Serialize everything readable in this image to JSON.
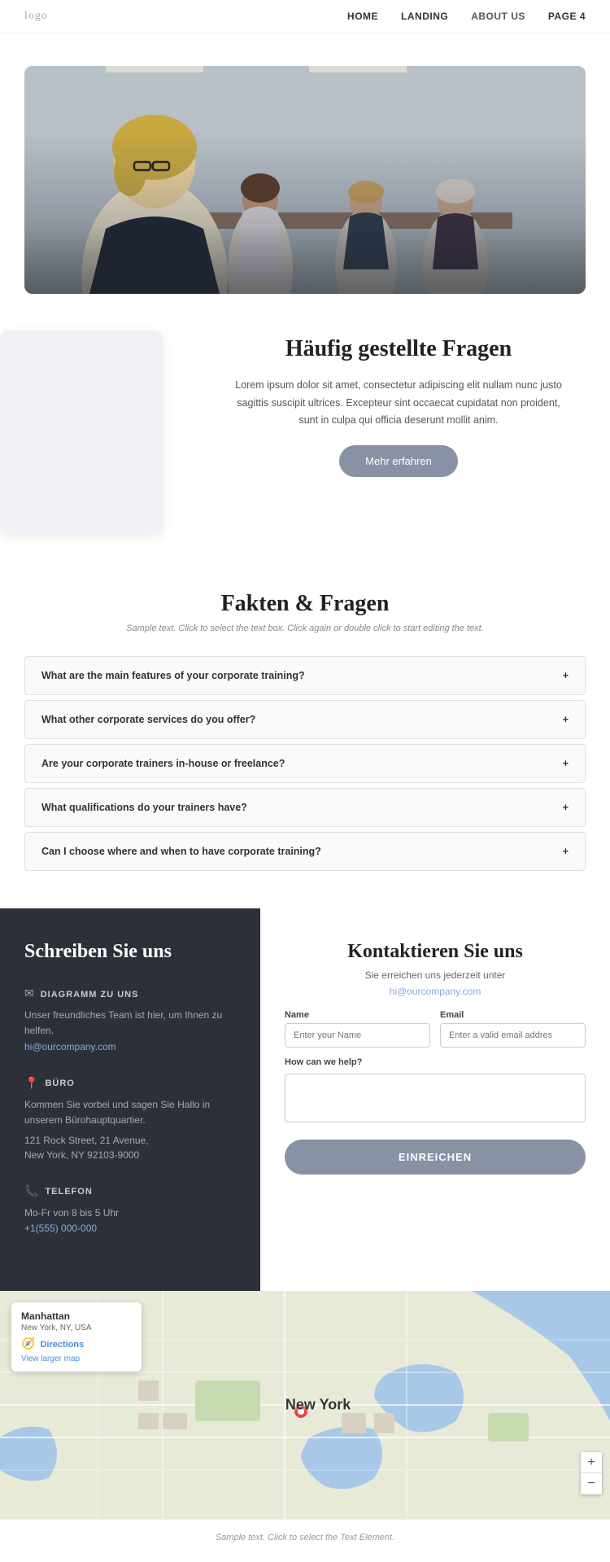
{
  "nav": {
    "logo": "logo",
    "links": [
      {
        "label": "HOME",
        "active": false
      },
      {
        "label": "LANDING",
        "active": false
      },
      {
        "label": "ABOUT US",
        "active": true
      },
      {
        "label": "PAGE 4",
        "active": false
      }
    ]
  },
  "hero": {
    "title": "Häufig gestellte Fragen",
    "body": "Lorem ipsum dolor sit amet, consectetur adipiscing elit nullam nunc justo sagittis suscipit ultrices. Excepteur sint occaecat cupidatat non proident, sunt in culpa qui officia deserunt mollit anim.",
    "button": "Mehr erfahren"
  },
  "faq_section": {
    "title": "Fakten & Fragen",
    "subtitle": "Sample text. Click to select the text box. Click again or double click to start editing the text.",
    "items": [
      "What are the main features of your corporate training?",
      "What other corporate services do you offer?",
      "Are your corporate trainers in-house or freelance?",
      "What qualifications do your trainers have?",
      "Can I choose where and when to have corporate training?"
    ]
  },
  "contact_left": {
    "title": "Schreiben Sie uns",
    "blocks": [
      {
        "icon": "✉",
        "heading": "DIAGRAMM ZU UNS",
        "text": "Unser freundliches Team ist hier, um Ihnen zu helfen.",
        "link": "hi@ourcompany.com"
      },
      {
        "icon": "📍",
        "heading": "BÜRO",
        "text": "Kommen Sie vorbei und sagen Sie Hallo in unserem Bürohauptquartier.",
        "address": "121 Rock Street, 21 Avenue,\nNew York, NY 92103-9000"
      },
      {
        "icon": "📞",
        "heading": "TELEFON",
        "text": "Mo-Fr von 8 bis 5 Uhr",
        "link": "+1(555) 000-000"
      }
    ]
  },
  "contact_right": {
    "title": "Kontaktieren Sie uns",
    "subtitle": "Sie erreichen uns jederzeit unter",
    "email_hint": "hi@ourcompany.com",
    "name_label": "Name",
    "name_placeholder": "Enter your Name",
    "email_label": "Email",
    "email_placeholder": "Enter a valid email addres",
    "help_label": "How can we help?",
    "submit_label": "EINREICHEN"
  },
  "map": {
    "location_name": "Manhattan",
    "location_address": "New York, NY, USA",
    "directions_label": "Directions",
    "larger_map_label": "View larger map",
    "label": "New York",
    "zoom_in": "+",
    "zoom_out": "−"
  },
  "footer": {
    "text": "Sample text. Click to select the Text Element."
  }
}
